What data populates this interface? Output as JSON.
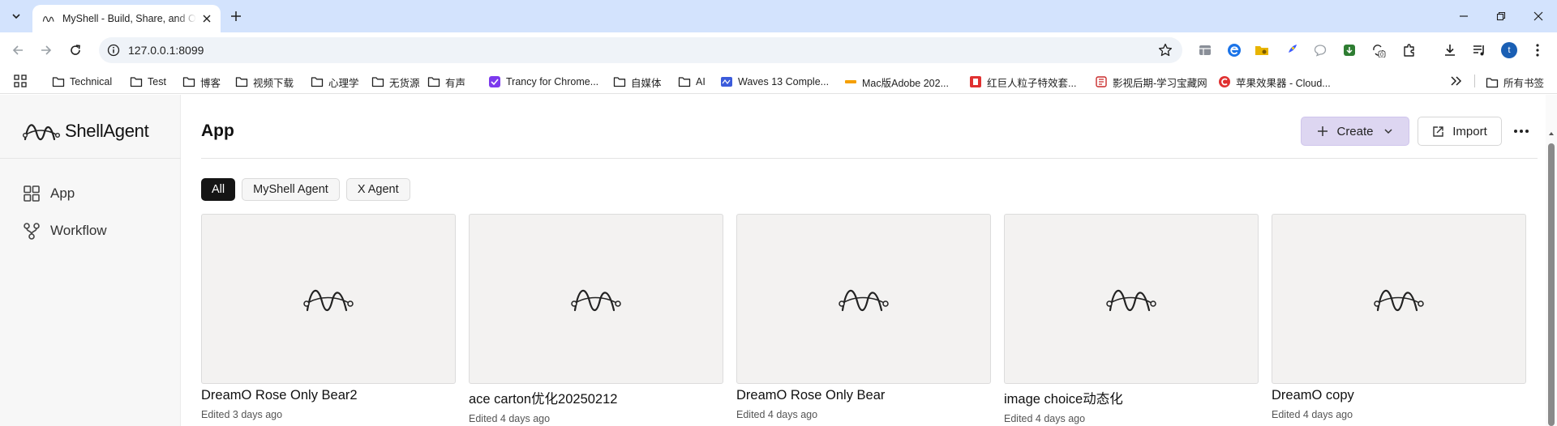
{
  "browser": {
    "tab": {
      "title": "MyShell - Build, Share, and Own AI Agents"
    },
    "url": "127.0.0.1:8099",
    "profile_initial": "t",
    "extension_badge": "0",
    "bookmarks": [
      {
        "label": "Technical",
        "icon": "folder-icon"
      },
      {
        "label": "Test",
        "icon": "folder-icon"
      },
      {
        "label": "博客",
        "icon": "folder-icon"
      },
      {
        "label": "视频下载",
        "icon": "folder-icon"
      },
      {
        "label": "心理学",
        "icon": "folder-icon"
      },
      {
        "label": "无货源",
        "icon": "folder-icon"
      },
      {
        "label": "有声",
        "icon": "folder-icon"
      },
      {
        "label": "Trancy for Chrome...",
        "icon": "trancy-icon"
      },
      {
        "label": "自媒体",
        "icon": "folder-icon"
      },
      {
        "label": "AI",
        "icon": "folder-icon"
      },
      {
        "label": "Waves 13 Comple...",
        "icon": "waves-icon"
      },
      {
        "label": "Mac版Adobe 202...",
        "icon": "adobe-mac-icon"
      },
      {
        "label": "红巨人粒子特效套...",
        "icon": "red-giant-icon"
      },
      {
        "label": "影视后期-学习宝藏网",
        "icon": "film-post-icon"
      },
      {
        "label": "苹果效果器 - Cloud...",
        "icon": "apple-effects-icon"
      }
    ],
    "all_bookmarks_label": "所有书签"
  },
  "app": {
    "brand_name": "ShellAgent",
    "sidebar": {
      "items": [
        {
          "label": "App",
          "icon": "grid-icon"
        },
        {
          "label": "Workflow",
          "icon": "workflow-icon"
        }
      ]
    },
    "page_title": "App",
    "create_label": "Create",
    "import_label": "Import",
    "filters": [
      {
        "label": "All",
        "active": true
      },
      {
        "label": "MyShell Agent",
        "active": false
      },
      {
        "label": "X Agent",
        "active": false
      }
    ],
    "cards": [
      {
        "name": "DreamO Rose Only Bear2",
        "meta": "Edited 3 days ago"
      },
      {
        "name": "ace carton优化20250212",
        "meta": "Edited 4 days ago"
      },
      {
        "name": "DreamO Rose Only Bear",
        "meta": "Edited 4 days ago"
      },
      {
        "name": "image choice动态化",
        "meta": "Edited 4 days ago"
      },
      {
        "name": "DreamO copy",
        "meta": "Edited 4 days ago"
      }
    ]
  },
  "colors": {
    "tabstrip_bg": "#d3e3fd",
    "create_button_bg": "#ddd6f1",
    "active_chip_bg": "#151515",
    "profile_bg": "#1a5fb4"
  }
}
